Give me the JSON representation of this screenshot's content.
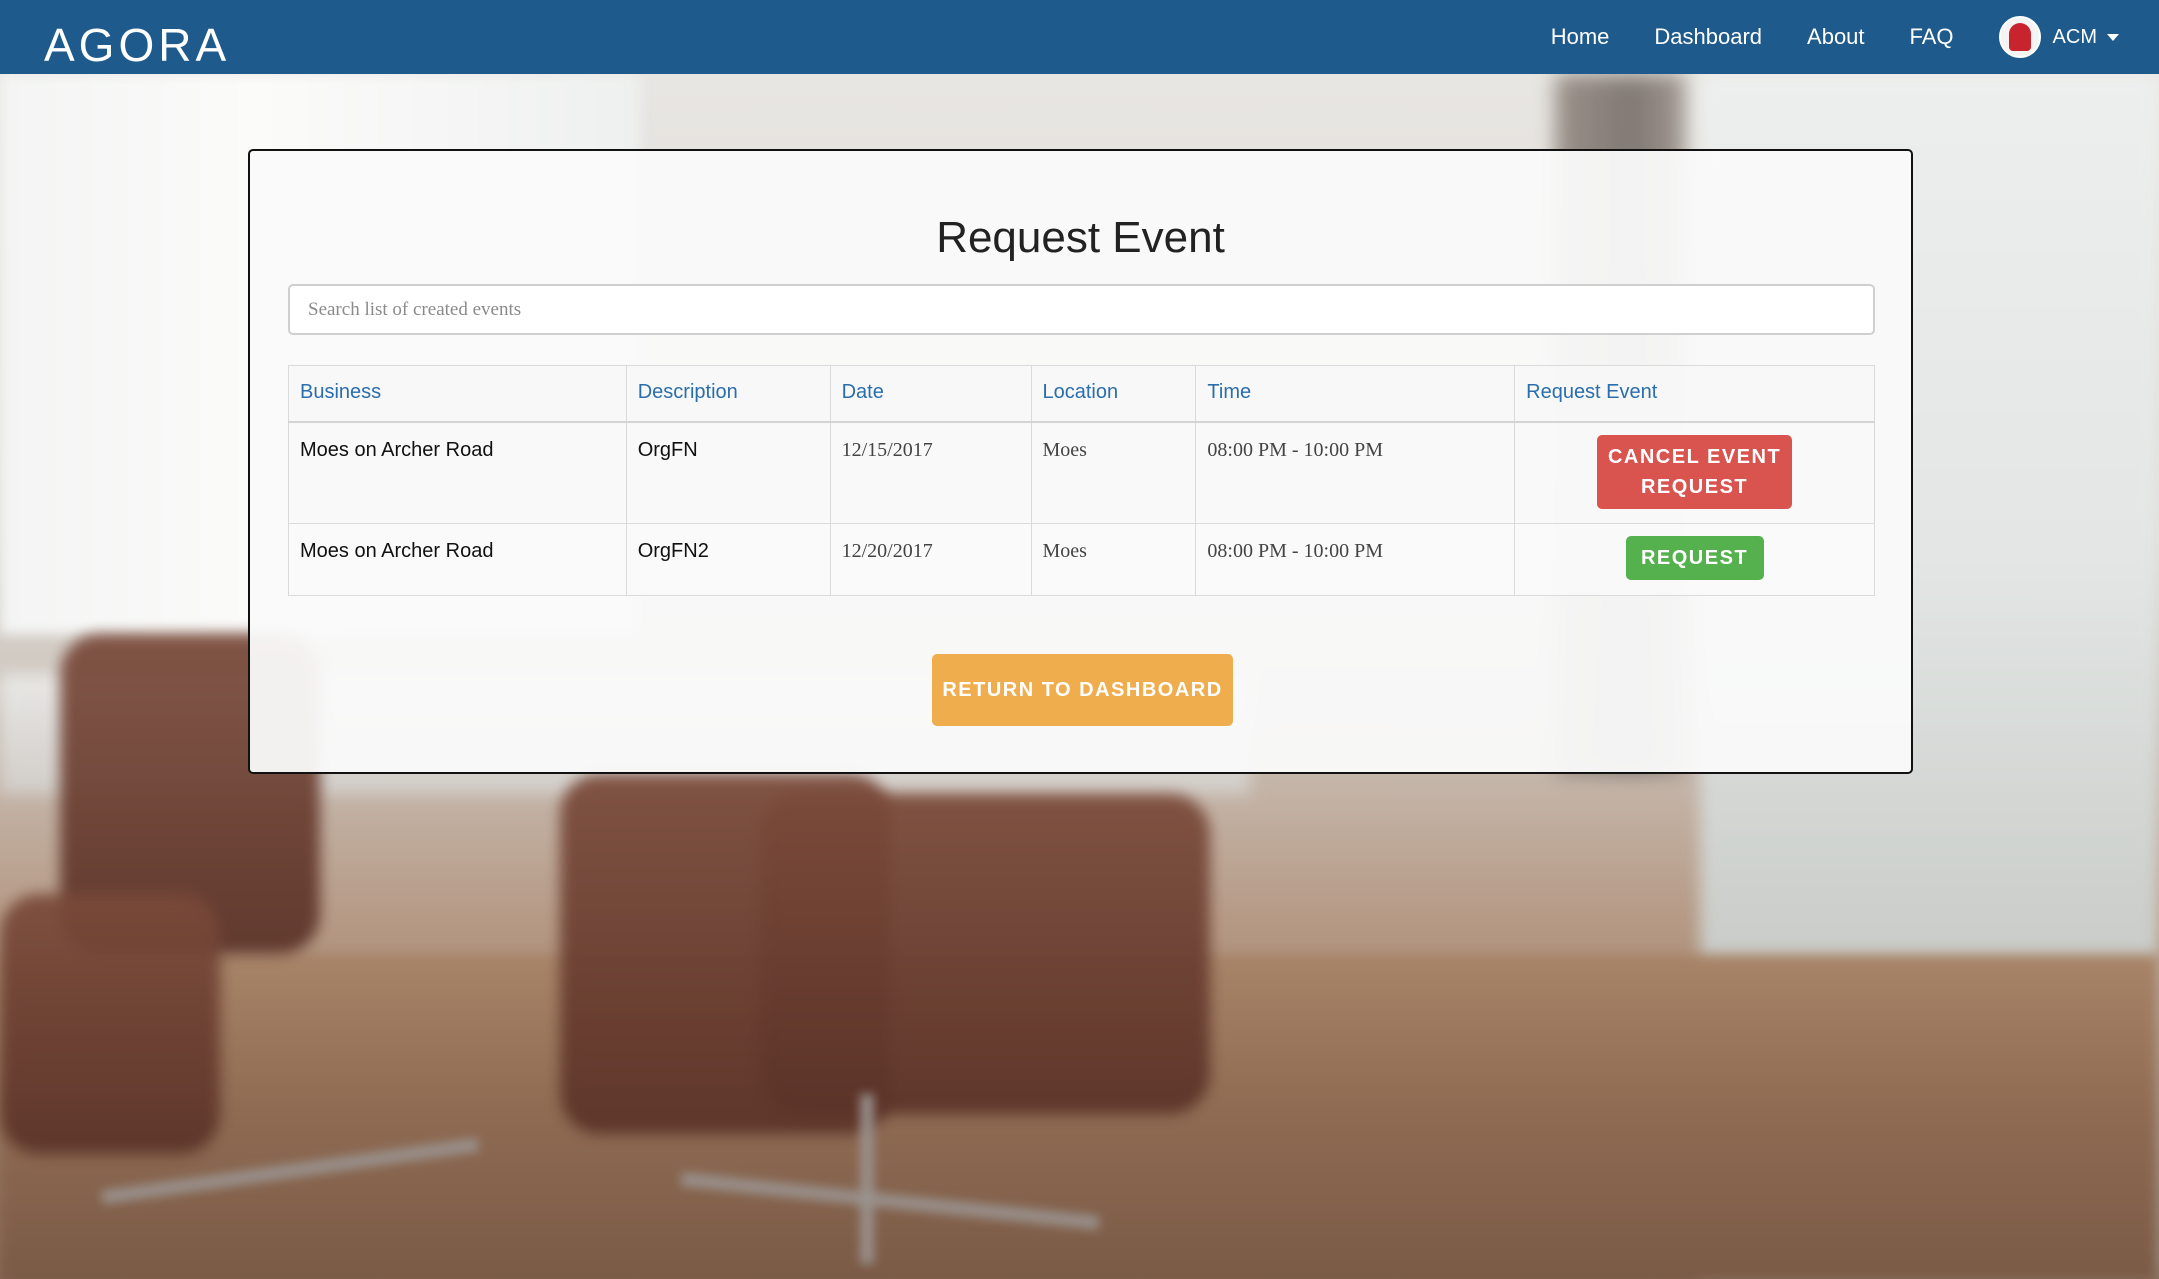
{
  "nav": {
    "logo": "AGORA",
    "links": [
      "Home",
      "Dashboard",
      "About",
      "FAQ"
    ],
    "user": "ACM"
  },
  "page": {
    "title": "Request Event",
    "search_placeholder": "Search list of created events"
  },
  "table": {
    "headers": [
      "Business",
      "Description",
      "Date",
      "Location",
      "Time",
      "Request Event"
    ],
    "rows": [
      {
        "business": "Moes on Archer Road",
        "description": "OrgFN",
        "date": "12/15/2017",
        "location": "Moes",
        "time": "08:00 PM - 10:00 PM",
        "action": "CANCEL EVENT REQUEST"
      },
      {
        "business": "Moes on Archer Road",
        "description": "OrgFN2",
        "date": "12/20/2017",
        "location": "Moes",
        "time": "08:00 PM - 10:00 PM",
        "action": "REQUEST"
      }
    ]
  },
  "footer": {
    "return_label": "RETURN TO DASHBOARD"
  },
  "colors": {
    "navbar": "#1f5a8c",
    "header_text": "#2a6ead",
    "danger": "#d9534f",
    "success": "#55b14d",
    "warning": "#f0ad4e"
  }
}
